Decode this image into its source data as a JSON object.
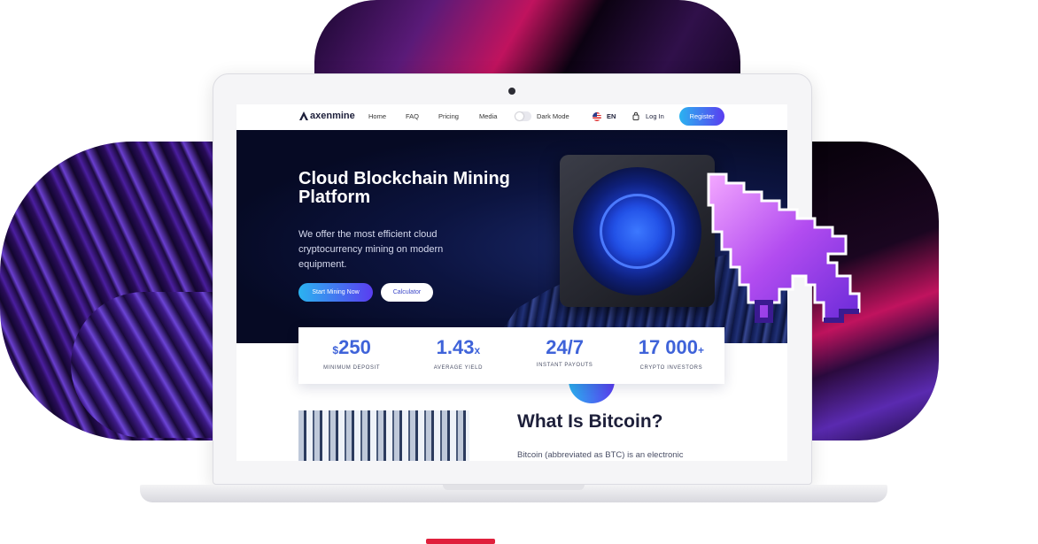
{
  "nav": {
    "logo": "axenmine",
    "links": [
      "Home",
      "FAQ",
      "Pricing",
      "Media"
    ],
    "dark_mode_label": "Dark Mode",
    "language": "EN",
    "login": "Log In",
    "register": "Register"
  },
  "hero": {
    "title": "Cloud Blockchain Mining Platform",
    "description": "We offer the most efficient cloud cryptocurrency mining on modern equipment.",
    "primary_button": "Start Mining Now",
    "secondary_button": "Calculator"
  },
  "stats": [
    {
      "prefix": "$",
      "value": "250",
      "suffix": "",
      "label": "MINIMUM DEPOSIT"
    },
    {
      "prefix": "",
      "value": "1.43",
      "suffix": "x",
      "label": "AVERAGE YIELD"
    },
    {
      "prefix": "",
      "value": "24/7",
      "suffix": "",
      "label": "INSTANT PAYOUTS"
    },
    {
      "prefix": "",
      "value": "17 000",
      "suffix": "+",
      "label": "CRYPTO INVESTORS"
    }
  ],
  "bitcoin": {
    "title": "What Is Bitcoin?",
    "text": "Bitcoin (abbreviated as BTC) is an electronic"
  },
  "colors": {
    "accent_start": "#2bb3f0",
    "accent_end": "#5a3df0",
    "stat_value": "#3f63d9",
    "hero_bg": "#060a24",
    "brand_red": "#e0203c"
  },
  "icons": [
    "axenmine-logo-icon",
    "us-flag-icon",
    "lock-icon",
    "pixel-cursor-icon"
  ]
}
